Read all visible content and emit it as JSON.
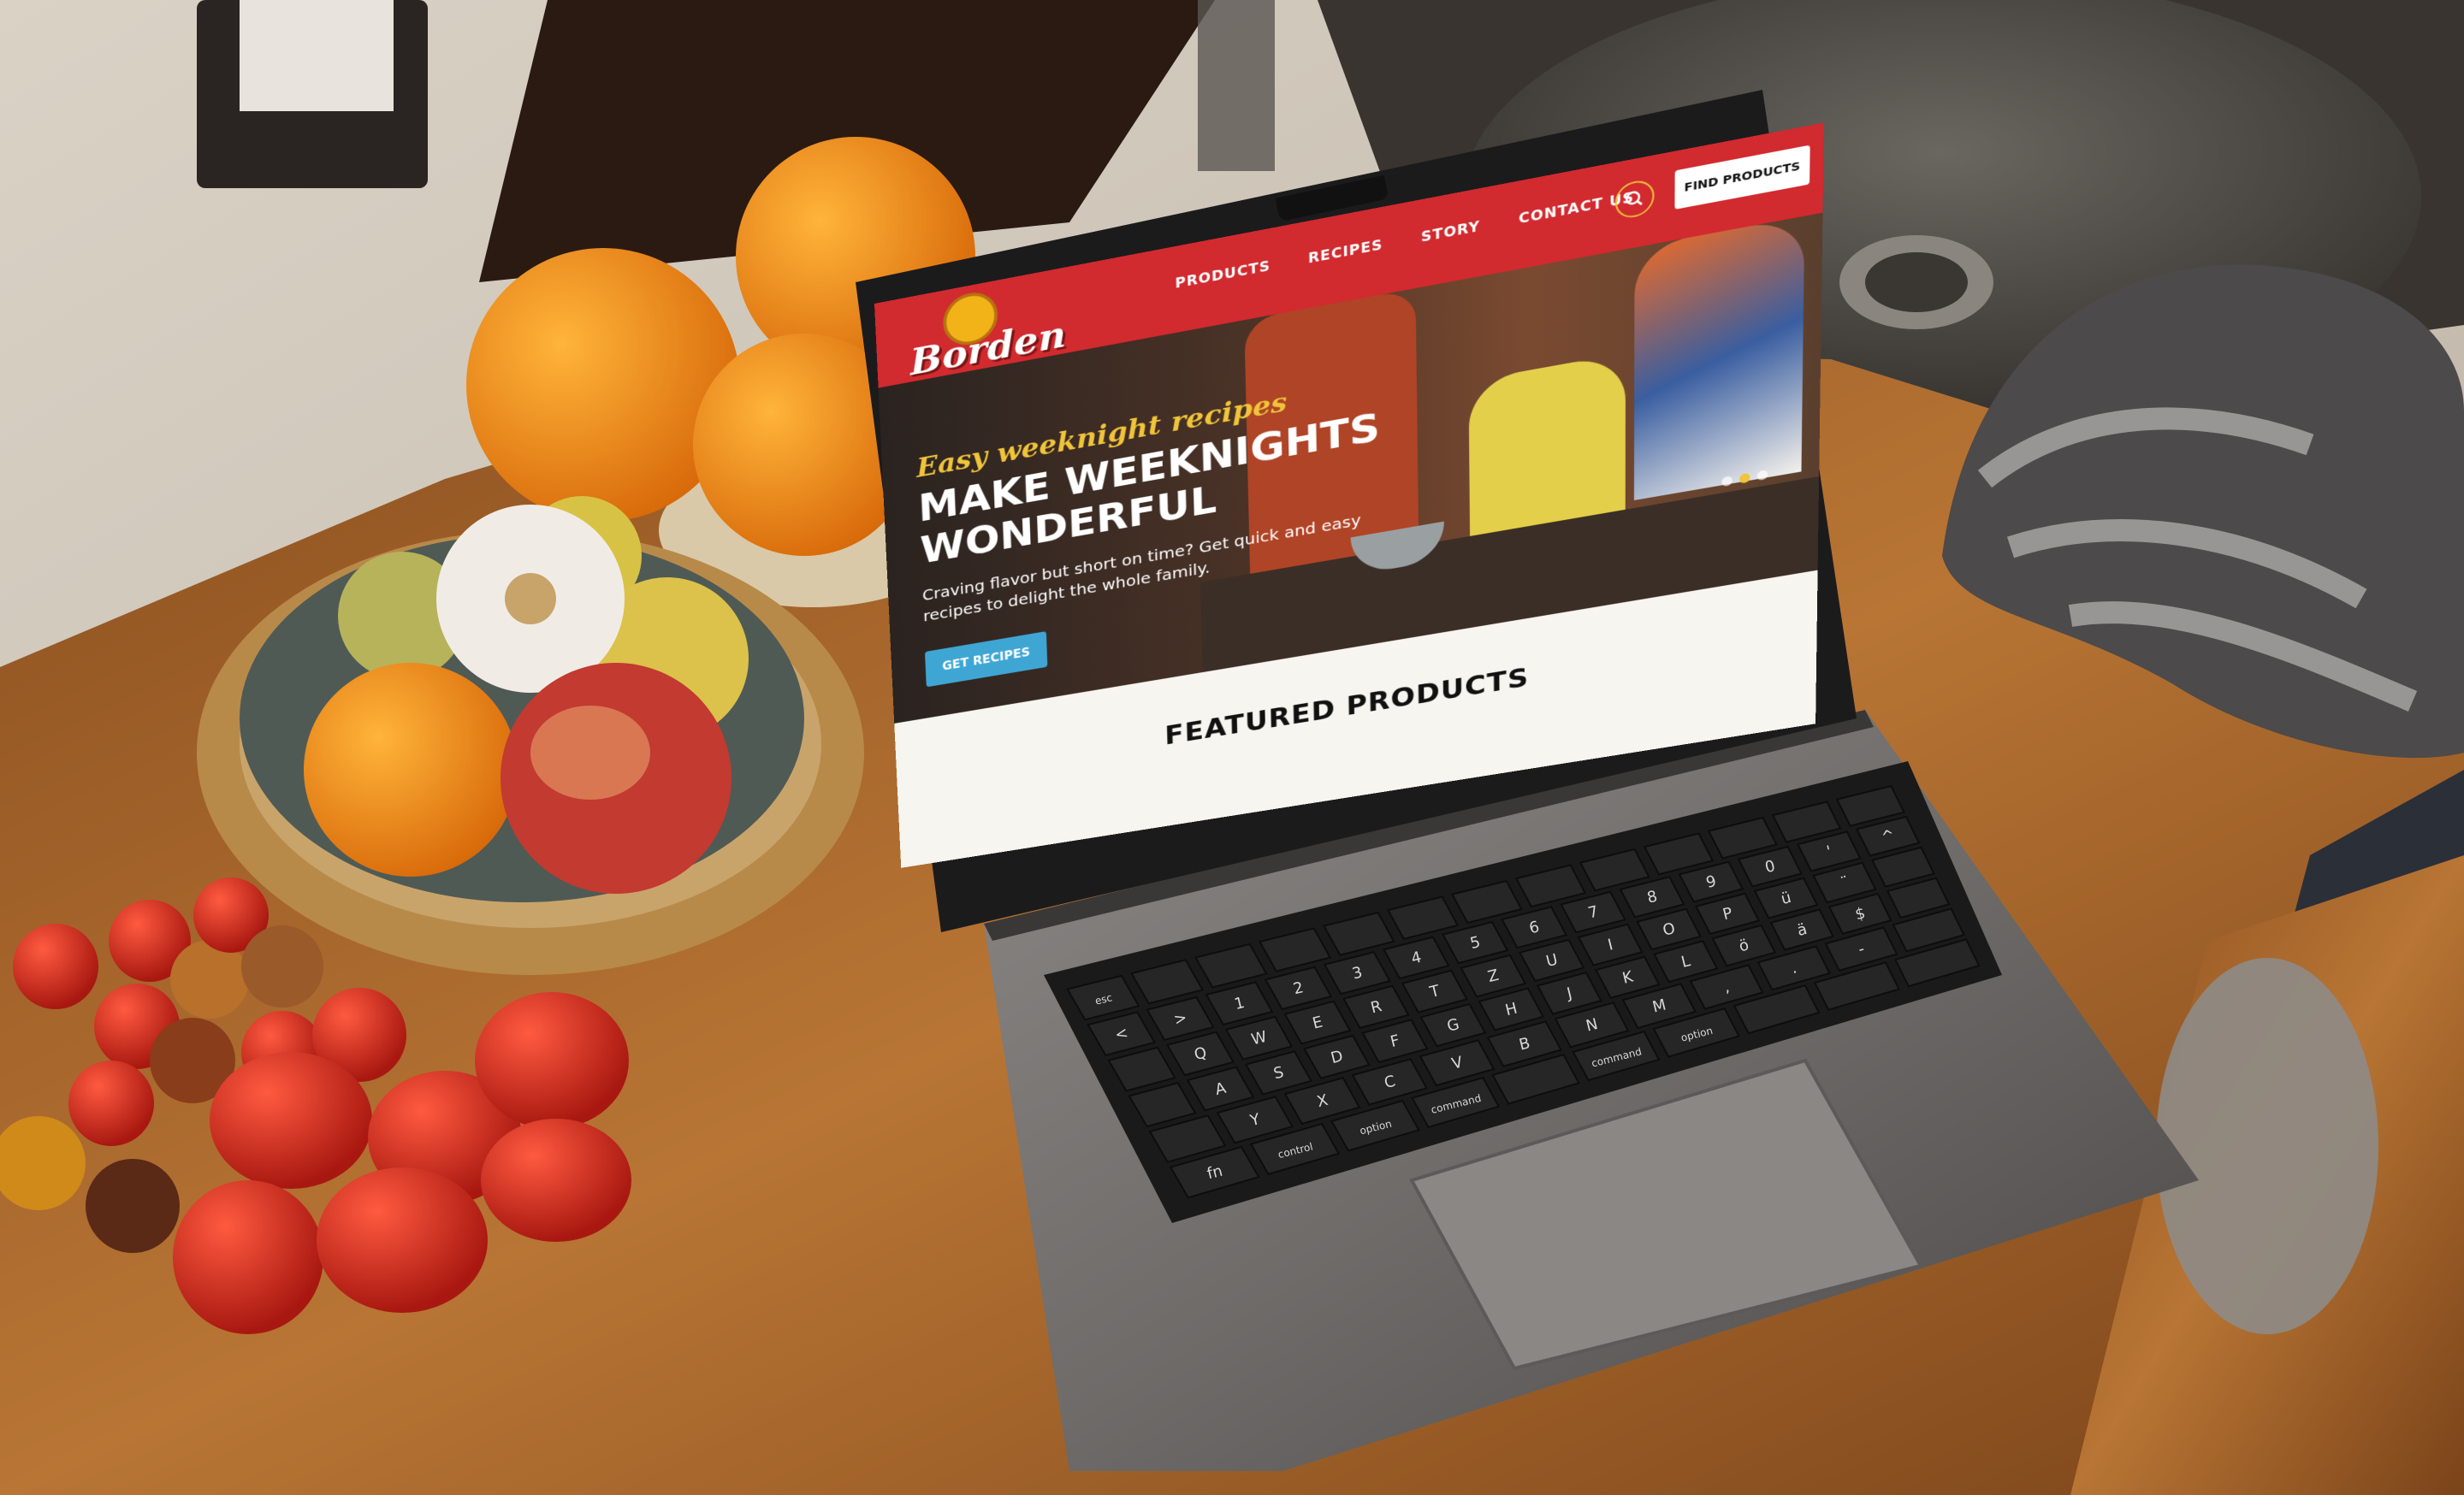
{
  "website": {
    "logo_text": "Borden",
    "nav": {
      "items": [
        "PRODUCTS",
        "RECIPES",
        "STORY",
        "CONTACT US"
      ],
      "cta_label": "FIND PRODUCTS",
      "search_icon": "search-icon"
    },
    "hero": {
      "eyebrow": "Easy weeknight recipes",
      "title_line1": "MAKE WEEKNIGHTS",
      "title_line2": "WONDERFUL",
      "subtitle_line1": "Craving flavor but short on time? Get quick and easy",
      "subtitle_line2": "recipes to delight the whole family.",
      "cta_label": "GET RECIPES",
      "slides": 3,
      "active_slide": 2
    },
    "featured": {
      "heading": "FEATURED PRODUCTS"
    }
  },
  "colors": {
    "brand_red": "#d12a2f",
    "cta_blue": "#3fa6d4",
    "logo_yellow": "#f2b319",
    "accent_yellow": "#f0c43a",
    "featured_bg": "#f7f5ef"
  },
  "keyboard": {
    "row1": [
      "esc",
      "",
      "",
      "",
      "",
      "",
      "",
      "",
      "",
      "",
      "",
      "",
      ""
    ],
    "row2": [
      "<",
      ">",
      "1",
      "2",
      "3",
      "4",
      "5",
      "6",
      "7",
      "8",
      "9",
      "0",
      "'",
      "^"
    ],
    "row3": [
      "",
      "Q",
      "W",
      "E",
      "R",
      "T",
      "Z",
      "U",
      "I",
      "O",
      "P",
      "ü",
      "¨",
      ""
    ],
    "row4": [
      "",
      "A",
      "S",
      "D",
      "F",
      "G",
      "H",
      "J",
      "K",
      "L",
      "ö",
      "ä",
      "$",
      ""
    ],
    "row5": [
      "",
      "Y",
      "X",
      "C",
      "V",
      "B",
      "N",
      "M",
      ",",
      ".",
      "-",
      ""
    ],
    "row6": [
      "fn",
      "control",
      "option",
      "command",
      "",
      "command",
      "option",
      "",
      "",
      ""
    ]
  }
}
